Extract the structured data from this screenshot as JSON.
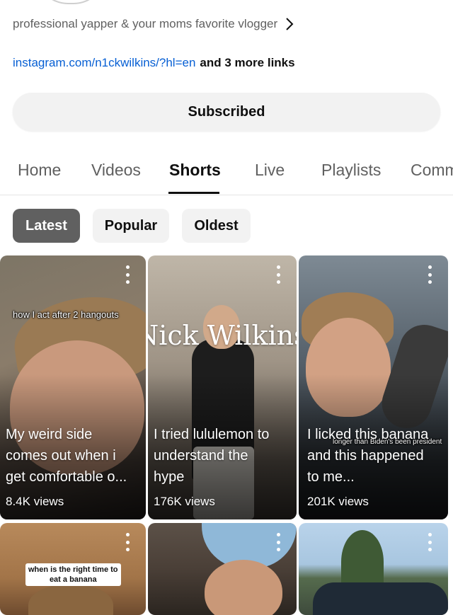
{
  "channel": {
    "bio": "professional yapper & your moms favorite vlogger",
    "link": "instagram.com/n1ckwilkins/?hl=en",
    "more_links": "and 3 more links",
    "subscribe_label": "Subscribed"
  },
  "tabs": [
    {
      "label": "Home"
    },
    {
      "label": "Videos"
    },
    {
      "label": "Shorts"
    },
    {
      "label": "Live"
    },
    {
      "label": "Playlists"
    },
    {
      "label": "Comm"
    }
  ],
  "active_tab": "Shorts",
  "filters": [
    {
      "label": "Latest",
      "selected": true
    },
    {
      "label": "Popular",
      "selected": false
    },
    {
      "label": "Oldest",
      "selected": false
    }
  ],
  "shorts": [
    {
      "title_lines": [
        "My weird side",
        "comes out when i",
        "get comfortable o..."
      ],
      "views": "8.4K views",
      "caption": "how I act after 2 hangouts"
    },
    {
      "title_lines": [
        "I tried lululemon to",
        "understand the",
        "hype"
      ],
      "views": "176K views",
      "watermark": "Nick Wilkins"
    },
    {
      "title_lines": [
        "I licked this banana",
        "and this happened",
        "to me..."
      ],
      "views": "201K views",
      "caption": "longer than Biden's been president"
    },
    {
      "caption_lines": [
        "when is the right time to",
        "eat a banana"
      ]
    },
    {},
    {}
  ],
  "colors": {
    "link": "#065fd4",
    "chip_selected": "#606060",
    "chip": "#f2f2f2"
  }
}
